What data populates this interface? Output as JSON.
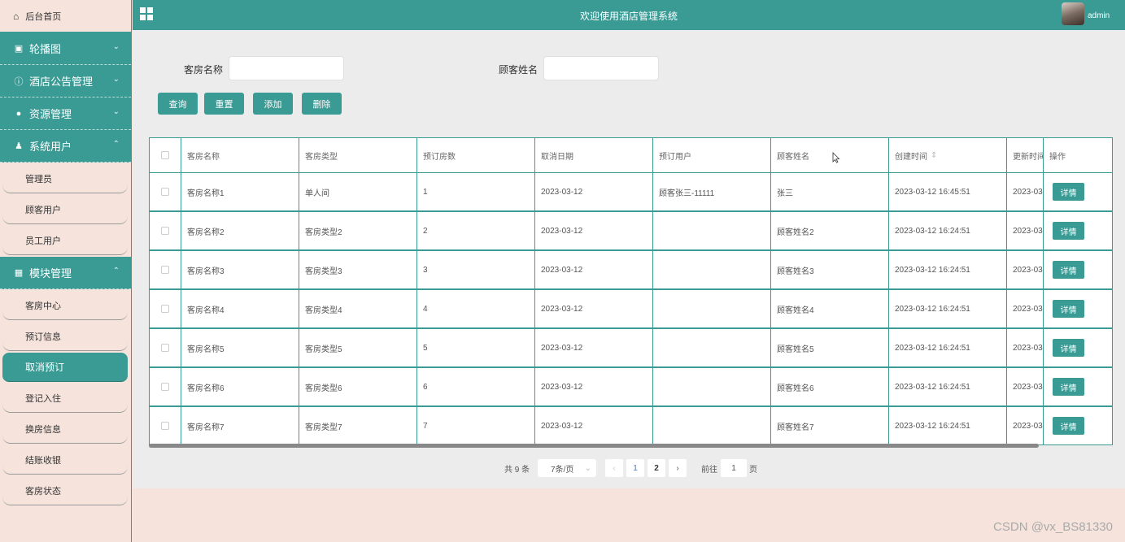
{
  "sidebar": {
    "home_label": "后台首页",
    "groups": [
      {
        "label": "轮播图",
        "icon": "image-icon",
        "chev": "⌄"
      },
      {
        "label": "酒店公告管理",
        "icon": "info-circle-icon",
        "chev": "⌄"
      },
      {
        "label": "资源管理",
        "icon": "bulb-icon",
        "chev": "⌄"
      },
      {
        "label": "系统用户",
        "icon": "user-icon",
        "chev": "⌃"
      },
      {
        "label": "模块管理",
        "icon": "grid-icon",
        "chev": "⌃"
      }
    ],
    "system_users": [
      "管理员",
      "顾客用户",
      "员工用户"
    ],
    "modules": [
      "客房中心",
      "预订信息",
      "取消预订",
      "登记入住",
      "换房信息",
      "结账收银",
      "客房状态"
    ],
    "active_item": "取消预订"
  },
  "header": {
    "title": "欢迎使用酒店管理系统",
    "username": "admin"
  },
  "search": {
    "room_name_label": "客房名称",
    "room_name_value": "",
    "guest_name_label": "顾客姓名",
    "guest_name_value": ""
  },
  "buttons": {
    "query": "查询",
    "reset": "重置",
    "add": "添加",
    "delete": "删除"
  },
  "table": {
    "columns": [
      "客房名称",
      "客房类型",
      "预订房数",
      "取消日期",
      "预订用户",
      "顾客姓名",
      "创建时间",
      "更新时间",
      "操作"
    ],
    "sort_icon": "⇕",
    "detail_label": "详情",
    "rows": [
      [
        "客房名称1",
        "单人间",
        "1",
        "2023-03-12",
        "顾客张三-11111",
        "张三",
        "2023-03-12 16:45:51",
        "2023-03"
      ],
      [
        "客房名称2",
        "客房类型2",
        "2",
        "2023-03-12",
        "",
        "顾客姓名2",
        "2023-03-12 16:24:51",
        "2023-03"
      ],
      [
        "客房名称3",
        "客房类型3",
        "3",
        "2023-03-12",
        "",
        "顾客姓名3",
        "2023-03-12 16:24:51",
        "2023-03"
      ],
      [
        "客房名称4",
        "客房类型4",
        "4",
        "2023-03-12",
        "",
        "顾客姓名4",
        "2023-03-12 16:24:51",
        "2023-03"
      ],
      [
        "客房名称5",
        "客房类型5",
        "5",
        "2023-03-12",
        "",
        "顾客姓名5",
        "2023-03-12 16:24:51",
        "2023-03"
      ],
      [
        "客房名称6",
        "客房类型6",
        "6",
        "2023-03-12",
        "",
        "顾客姓名6",
        "2023-03-12 16:24:51",
        "2023-03"
      ],
      [
        "客房名称7",
        "客房类型7",
        "7",
        "2023-03-12",
        "",
        "顾客姓名7",
        "2023-03-12 16:24:51",
        "2023-03"
      ]
    ]
  },
  "pager": {
    "total": "共 9 条",
    "page_size": "7条/页",
    "pages": [
      "1",
      "2"
    ],
    "current_page": "1",
    "goto_label": "前往",
    "goto_value": "1",
    "page_suffix": "页",
    "prev_icon": "‹",
    "next_icon": "›",
    "dropdown_icon": "⌄"
  },
  "watermark": "CSDN @vx_BS81330",
  "colors": {
    "primary": "#3a9a94",
    "background": "#f5e3dc",
    "content_bg": "#ececec"
  }
}
